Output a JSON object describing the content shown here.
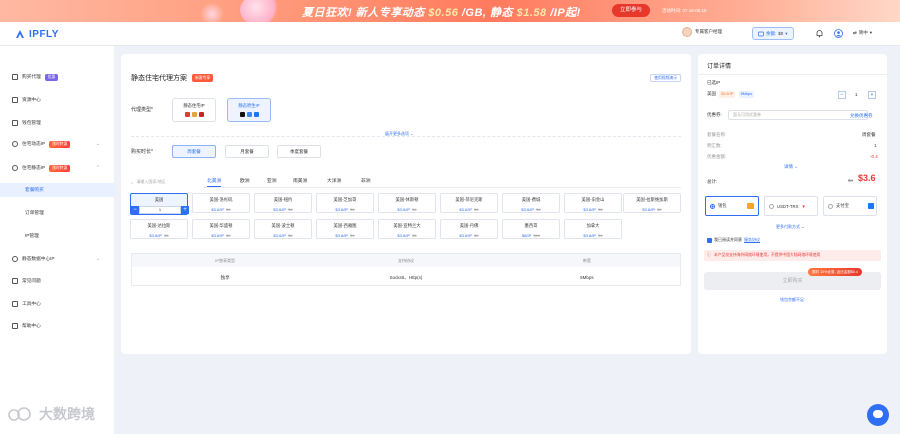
{
  "banner": {
    "headline_a": "夏日狂欢! 新人专享动态",
    "price_dynamic": "$0.56",
    "headline_b": "/GB, 静态",
    "price_static": "$1.58",
    "headline_c": "/IP起!",
    "cta": "立即参与",
    "period": "活动时间: 07.16-08.15"
  },
  "topbar": {
    "logo": "IPFLY",
    "manager": "专属客户经理",
    "balance_label": "余额:",
    "balance_value": "$0",
    "language": "简中"
  },
  "sidebar": {
    "items": [
      {
        "label": "购买代理",
        "tag": "优惠"
      },
      {
        "label": "资源中心"
      },
      {
        "label": "钱包管理"
      },
      {
        "label": "住宅动态IP",
        "tag": "限时特惠"
      },
      {
        "label": "住宅静态IP",
        "tag": "限时特惠"
      },
      {
        "label": "套餐购买"
      },
      {
        "label": "订单管理"
      },
      {
        "label": "IP管理"
      },
      {
        "label": "静态数据中心IP"
      },
      {
        "label": "常见问题"
      },
      {
        "label": "工具中心"
      },
      {
        "label": "帮助中心"
      }
    ]
  },
  "main": {
    "title": "静态住宅代理方案",
    "title_badge": "新客专享",
    "guide_link": "使用视频演示",
    "proxy_type_label": "代理类型*",
    "proxy_types": [
      {
        "label": "静态住宅IP"
      },
      {
        "label": "静态原生IP"
      }
    ],
    "expand_link": "展开更多选项",
    "duration_label": "购买时长*",
    "durations": [
      "周套餐",
      "月套餐",
      "季度套餐"
    ],
    "search_placeholder": "请输入国家/地区",
    "continents": [
      "北美洲",
      "欧洲",
      "亚洲",
      "南美洲",
      "大洋洲",
      "非洲"
    ],
    "cities": [
      {
        "name": "美国",
        "qty": "1"
      },
      {
        "name": "美国-洛杉矶",
        "price": "$3.6/IP",
        "old": "$4"
      },
      {
        "name": "美国-纽约",
        "price": "$3.6/IP",
        "old": "$4"
      },
      {
        "name": "美国-芝加哥",
        "price": "$3.6/IP",
        "old": "$4"
      },
      {
        "name": "美国-休斯顿",
        "price": "$3.6/IP",
        "old": "$4"
      },
      {
        "name": "美国-菲尼克斯",
        "price": "$3.6/IP",
        "old": "$4"
      },
      {
        "name": "美国-费城",
        "price": "$3.6/IP",
        "old": "$4"
      },
      {
        "name": "美国-旧金山",
        "price": "$3.6/IP",
        "old": "$4"
      },
      {
        "name": "美国-拉斯维加斯",
        "price": "$3.6/IP",
        "old": "$4"
      },
      {
        "name": "美国-达拉斯",
        "price": "$3.6/IP",
        "old": "$4"
      },
      {
        "name": "美国-华盛顿",
        "price": "$3.6/IP",
        "old": "$4"
      },
      {
        "name": "美国-波士顿",
        "price": "$3.6/IP",
        "old": "$4"
      },
      {
        "name": "美国-西雅图",
        "price": "$3.6/IP",
        "old": "$4"
      },
      {
        "name": "美国-亚特兰大",
        "price": "$3.6/IP",
        "old": "$4"
      },
      {
        "name": "美国-丹佛",
        "price": "$3.6/IP",
        "old": "$4"
      },
      {
        "name": "墨西哥",
        "price": "$8/IP",
        "old": "$10"
      },
      {
        "name": "加拿大",
        "price": "$3.6/IP",
        "old": "$4"
      }
    ],
    "spec_headers": [
      "IP独享类型",
      "支持协议",
      "带宽"
    ],
    "spec_values": [
      "独享",
      "Socks5、Http(s)",
      "5Mbps"
    ]
  },
  "order": {
    "title": "订单详情",
    "selected_ip": "已选IP",
    "item_country": "美国",
    "item_price": "$3.6/IP",
    "item_bw": "5Mbps",
    "qty": "1",
    "coupon_label": "优惠券:",
    "coupon_placeholder": "暂无可用优惠券",
    "coupon_link": "兑换优惠券",
    "pkg_name_label": "套餐名称:",
    "pkg_name": "周套餐",
    "qty_label": "明汇数:",
    "qty_value": "1",
    "discount_label": "优惠金额:",
    "discount_value": "-0.4",
    "detail_link": "详情",
    "total_label": "总计:",
    "total_old": "$4",
    "total": "$3.6",
    "pay_methods": [
      "钱包",
      "USDT-TRX",
      "支付宝"
    ],
    "more_pay": "更多付款方式",
    "agree": "我已阅读并同意",
    "agree_link": "服务协议",
    "warning": "本产品仅支持海外网络环境使用，不提供中国大陆网络环境使用",
    "promo": "限时 10%优惠, 返还金额$0.4",
    "buy": "立即购买",
    "low_balance": "钱包余额不足"
  },
  "watermark": "大数跨境",
  "colors": {
    "brand": "#2f6ff5",
    "alert": "#e53935",
    "promo": "#ff5a3c"
  }
}
